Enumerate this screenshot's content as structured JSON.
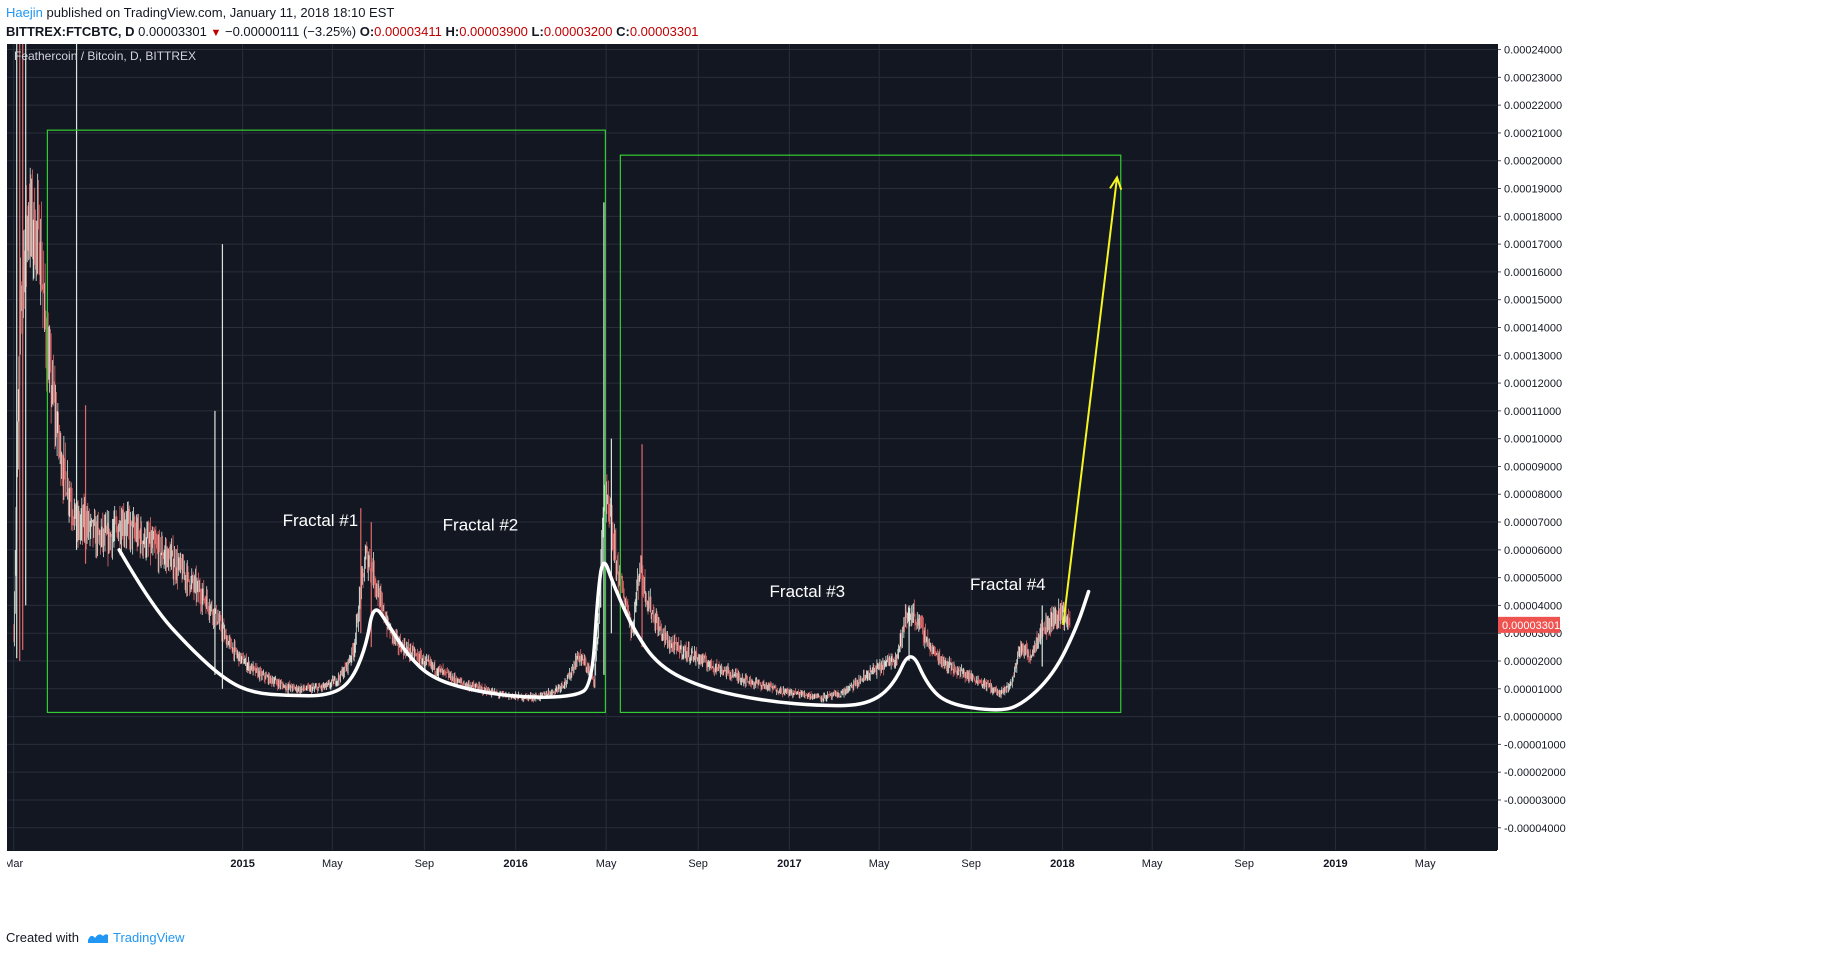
{
  "header": {
    "author": "Haejin",
    "published_text": "published on TradingView.com, January 11, 2018 18:10 EST",
    "symbol": "BITTREX:FTCBTC, D",
    "last_price": "0.00003301",
    "change": "−0.00000111 (−3.25%)",
    "open_label": "O:",
    "open": "0.00003411",
    "high_label": "H:",
    "high": "0.00003900",
    "low_label": "L:",
    "low": "0.00003200",
    "close_label": "C:",
    "close": "0.00003301"
  },
  "footer": {
    "created_with": "Created with",
    "brand": "TradingView"
  },
  "colors": {
    "background": "#131722",
    "grid": "#2a2e39",
    "candle_up": "#d9e6dc",
    "candle_down": "#e06a6a",
    "box": "#33cc33",
    "fractal_curve": "#ffffff",
    "arrow": "#f5f522",
    "price_badge": "#ef5350"
  },
  "chart_data": {
    "type": "candlestick",
    "title": "Feathercoin / Bitcoin, D, BITTREX",
    "ylim": [
      -4.8e-05,
      0.000242
    ],
    "y_ticks": [
      "0.00024000",
      "0.00023000",
      "0.00022000",
      "0.00021000",
      "0.00020000",
      "0.00019000",
      "0.00018000",
      "0.00017000",
      "0.00016000",
      "0.00015000",
      "0.00014000",
      "0.00013000",
      "0.00012000",
      "0.00011000",
      "0.00010000",
      "0.00009000",
      "0.00008000",
      "0.00007000",
      "0.00006000",
      "0.00005000",
      "0.00004000",
      "0.00003000",
      "0.00002000",
      "0.00001000",
      "0.00000000",
      "-0.00001000",
      "-0.00002000",
      "-0.00003000",
      "-0.00004000"
    ],
    "x_range": [
      "2014-02-20",
      "2019-08-05"
    ],
    "x_ticks": [
      {
        "label": "Mar",
        "date": "2014-03-01",
        "bold": false
      },
      {
        "label": "2015",
        "date": "2015-01-01",
        "bold": true
      },
      {
        "label": "May",
        "date": "2015-05-01",
        "bold": false
      },
      {
        "label": "Sep",
        "date": "2015-09-01",
        "bold": false
      },
      {
        "label": "2016",
        "date": "2016-01-01",
        "bold": true
      },
      {
        "label": "May",
        "date": "2016-05-01",
        "bold": false
      },
      {
        "label": "Sep",
        "date": "2016-09-01",
        "bold": false
      },
      {
        "label": "2017",
        "date": "2017-01-01",
        "bold": true
      },
      {
        "label": "May",
        "date": "2017-05-01",
        "bold": false
      },
      {
        "label": "Sep",
        "date": "2017-09-01",
        "bold": false
      },
      {
        "label": "2018",
        "date": "2018-01-01",
        "bold": true
      },
      {
        "label": "May",
        "date": "2018-05-01",
        "bold": false
      },
      {
        "label": "Sep",
        "date": "2018-09-01",
        "bold": false
      },
      {
        "label": "2019",
        "date": "2019-01-01",
        "bold": true
      },
      {
        "label": "May",
        "date": "2019-05-01",
        "bold": false
      }
    ],
    "current_price": 3.301e-05,
    "current_price_label": "0.00003301",
    "price_path": [
      [
        "2014-03-01",
        3e-05
      ],
      [
        "2014-03-10",
        0.00015
      ],
      [
        "2014-03-20",
        0.00018
      ],
      [
        "2014-04-05",
        0.00017
      ],
      [
        "2014-04-15",
        0.00013
      ],
      [
        "2014-04-25",
        0.00011
      ],
      [
        "2014-05-05",
        9e-05
      ],
      [
        "2014-05-15",
        8e-05
      ],
      [
        "2014-05-25",
        6.8e-05
      ],
      [
        "2014-06-05",
        7e-05
      ],
      [
        "2014-06-20",
        6.5e-05
      ],
      [
        "2014-07-05",
        6.4e-05
      ],
      [
        "2014-07-25",
        7e-05
      ],
      [
        "2014-08-10",
        6.6e-05
      ],
      [
        "2014-08-25",
        6.3e-05
      ],
      [
        "2014-09-10",
        6e-05
      ],
      [
        "2014-09-25",
        5.7e-05
      ],
      [
        "2014-10-10",
        5.3e-05
      ],
      [
        "2014-10-25",
        4.8e-05
      ],
      [
        "2014-11-10",
        4.3e-05
      ],
      [
        "2014-11-25",
        3.7e-05
      ],
      [
        "2014-12-10",
        2.8e-05
      ],
      [
        "2014-12-25",
        2.2e-05
      ],
      [
        "2015-01-10",
        1.8e-05
      ],
      [
        "2015-01-25",
        1.5e-05
      ],
      [
        "2015-02-10",
        1.3e-05
      ],
      [
        "2015-02-25",
        1.1e-05
      ],
      [
        "2015-03-15",
        1e-05
      ],
      [
        "2015-04-05",
        1e-05
      ],
      [
        "2015-04-25",
        1.1e-05
      ],
      [
        "2015-05-10",
        1.4e-05
      ],
      [
        "2015-05-20",
        1.8e-05
      ],
      [
        "2015-05-30",
        2.5e-05
      ],
      [
        "2015-06-08",
        4.5e-05
      ],
      [
        "2015-06-15",
        5.8e-05
      ],
      [
        "2015-06-25",
        5.2e-05
      ],
      [
        "2015-07-05",
        4e-05
      ],
      [
        "2015-07-15",
        3.2e-05
      ],
      [
        "2015-07-28",
        2.6e-05
      ],
      [
        "2015-08-15",
        2.3e-05
      ],
      [
        "2015-09-05",
        1.9e-05
      ],
      [
        "2015-09-25",
        1.6e-05
      ],
      [
        "2015-10-20",
        1.2e-05
      ],
      [
        "2015-11-15",
        1e-05
      ],
      [
        "2015-12-10",
        8e-06
      ],
      [
        "2016-01-05",
        7e-06
      ],
      [
        "2016-01-30",
        7e-06
      ],
      [
        "2016-02-20",
        9e-06
      ],
      [
        "2016-03-10",
        1.3e-05
      ],
      [
        "2016-03-25",
        2.2e-05
      ],
      [
        "2016-04-05",
        1.8e-05
      ],
      [
        "2016-04-15",
        1.3e-05
      ],
      [
        "2016-04-22",
        4e-05
      ],
      [
        "2016-04-28",
        8e-05
      ],
      [
        "2016-05-05",
        7.2e-05
      ],
      [
        "2016-05-12",
        6e-05
      ],
      [
        "2016-05-20",
        4.8e-05
      ],
      [
        "2016-05-30",
        3.8e-05
      ],
      [
        "2016-06-05",
        3e-05
      ],
      [
        "2016-06-15",
        5.5e-05
      ],
      [
        "2016-06-25",
        4.2e-05
      ],
      [
        "2016-07-10",
        3.2e-05
      ],
      [
        "2016-07-25",
        2.6e-05
      ],
      [
        "2016-08-10",
        2.4e-05
      ],
      [
        "2016-08-25",
        2.2e-05
      ],
      [
        "2016-09-15",
        1.9e-05
      ],
      [
        "2016-10-10",
        1.6e-05
      ],
      [
        "2016-11-05",
        1.3e-05
      ],
      [
        "2016-12-01",
        1.1e-05
      ],
      [
        "2016-12-25",
        9e-06
      ],
      [
        "2017-01-20",
        8e-06
      ],
      [
        "2017-02-15",
        7e-06
      ],
      [
        "2017-03-10",
        8e-06
      ],
      [
        "2017-04-01",
        1.2e-05
      ],
      [
        "2017-04-20",
        1.6e-05
      ],
      [
        "2017-05-10",
        1.9e-05
      ],
      [
        "2017-05-25",
        2.2e-05
      ],
      [
        "2017-06-05",
        3.5e-05
      ],
      [
        "2017-06-15",
        3.7e-05
      ],
      [
        "2017-06-25",
        3.3e-05
      ],
      [
        "2017-07-10",
        2.4e-05
      ],
      [
        "2017-07-25",
        2e-05
      ],
      [
        "2017-08-10",
        1.7e-05
      ],
      [
        "2017-08-25",
        1.5e-05
      ],
      [
        "2017-09-10",
        1.3e-05
      ],
      [
        "2017-09-25",
        1.1e-05
      ],
      [
        "2017-10-10",
        8e-06
      ],
      [
        "2017-10-25",
        1.2e-05
      ],
      [
        "2017-11-05",
        2.5e-05
      ],
      [
        "2017-11-20",
        2.2e-05
      ],
      [
        "2017-12-01",
        3e-05
      ],
      [
        "2017-12-15",
        3.4e-05
      ],
      [
        "2018-01-01",
        3.8e-05
      ],
      [
        "2018-01-11",
        3.3e-05
      ]
    ],
    "spikes": [
      [
        "2014-03-05",
        0.000242,
        2.1e-05
      ],
      [
        "2014-03-09",
        0.000242,
        2e-05
      ],
      [
        "2014-03-13",
        0.000242,
        2.4e-05
      ],
      [
        "2014-03-17",
        0.000242,
        4e-05
      ],
      [
        "2014-05-24",
        0.000242,
        6e-05
      ],
      [
        "2014-06-05",
        0.000112,
        5.5e-05
      ],
      [
        "2014-12-05",
        0.00017,
        1e-05
      ],
      [
        "2014-11-25",
        0.00011,
        1.5e-05
      ],
      [
        "2015-06-08",
        7.5e-05,
        3e-05
      ],
      [
        "2015-06-22",
        7e-05,
        2.5e-05
      ],
      [
        "2016-04-28",
        0.000185,
        1.5e-05
      ],
      [
        "2016-05-08",
        0.0001,
        3e-05
      ],
      [
        "2016-06-18",
        9.8e-05,
        2.5e-05
      ],
      [
        "2017-06-10",
        4e-05,
        2e-05
      ],
      [
        "2017-12-05",
        4e-05,
        1.8e-05
      ]
    ],
    "boxes": [
      {
        "x0": "2014-04-15",
        "x1": "2016-04-30",
        "y0": 1.5e-06,
        "y1": 0.000211
      },
      {
        "x0": "2016-05-20",
        "x1": "2018-03-20",
        "y0": 1.5e-06,
        "y1": 0.000202
      }
    ],
    "annotations": [
      {
        "text": "Fractal #1",
        "date": "2015-04-15",
        "price": 6.85e-05
      },
      {
        "text": "Fractal #2",
        "date": "2015-11-15",
        "price": 6.7e-05
      },
      {
        "text": "Fractal #3",
        "date": "2017-01-25",
        "price": 4.3e-05
      },
      {
        "text": "Fractal #4",
        "date": "2017-10-20",
        "price": 4.55e-05
      }
    ],
    "fractal_curve": [
      [
        "2014-07-20",
        6e-05
      ],
      [
        "2014-09-01",
        4e-05
      ],
      [
        "2014-10-25",
        2.4e-05
      ],
      [
        "2014-12-10",
        1.3e-05
      ],
      [
        "2015-01-15",
        8.5e-06
      ],
      [
        "2015-03-05",
        7.5e-06
      ],
      [
        "2015-04-25",
        7.5e-06
      ],
      [
        "2015-05-25",
        1.2e-05
      ],
      [
        "2015-06-15",
        2.5e-05
      ],
      [
        "2015-06-25",
        4.1e-05
      ],
      [
        "2015-07-15",
        3.3e-05
      ],
      [
        "2015-08-10",
        2.2e-05
      ],
      [
        "2015-09-10",
        1.4e-05
      ],
      [
        "2015-11-01",
        9.5e-06
      ],
      [
        "2016-01-10",
        6.8e-06
      ],
      [
        "2016-03-20",
        7.2e-06
      ],
      [
        "2016-04-12",
        1.1e-05
      ],
      [
        "2016-04-20",
        4.5e-05
      ],
      [
        "2016-04-27",
        5.8e-05
      ],
      [
        "2016-05-10",
        4.8e-05
      ],
      [
        "2016-06-05",
        3.2e-05
      ],
      [
        "2016-07-10",
        1.8e-05
      ],
      [
        "2016-09-10",
        1e-05
      ],
      [
        "2016-12-01",
        5.5e-06
      ],
      [
        "2017-02-15",
        3.8e-06
      ],
      [
        "2017-04-15",
        4.2e-06
      ],
      [
        "2017-05-20",
        1.1e-05
      ],
      [
        "2017-06-12",
        2.5e-05
      ],
      [
        "2017-07-05",
        1.1e-05
      ],
      [
        "2017-08-01",
        4.5e-06
      ],
      [
        "2017-10-01",
        2e-06
      ],
      [
        "2017-11-05",
        3.5e-06
      ],
      [
        "2017-12-20",
        1.5e-05
      ],
      [
        "2018-01-20",
        3.2e-05
      ],
      [
        "2018-02-05",
        4.5e-05
      ]
    ],
    "arrow": {
      "from": [
        "2018-01-02",
        3.3e-05
      ],
      "to": [
        "2018-03-15",
        0.000194
      ]
    }
  }
}
